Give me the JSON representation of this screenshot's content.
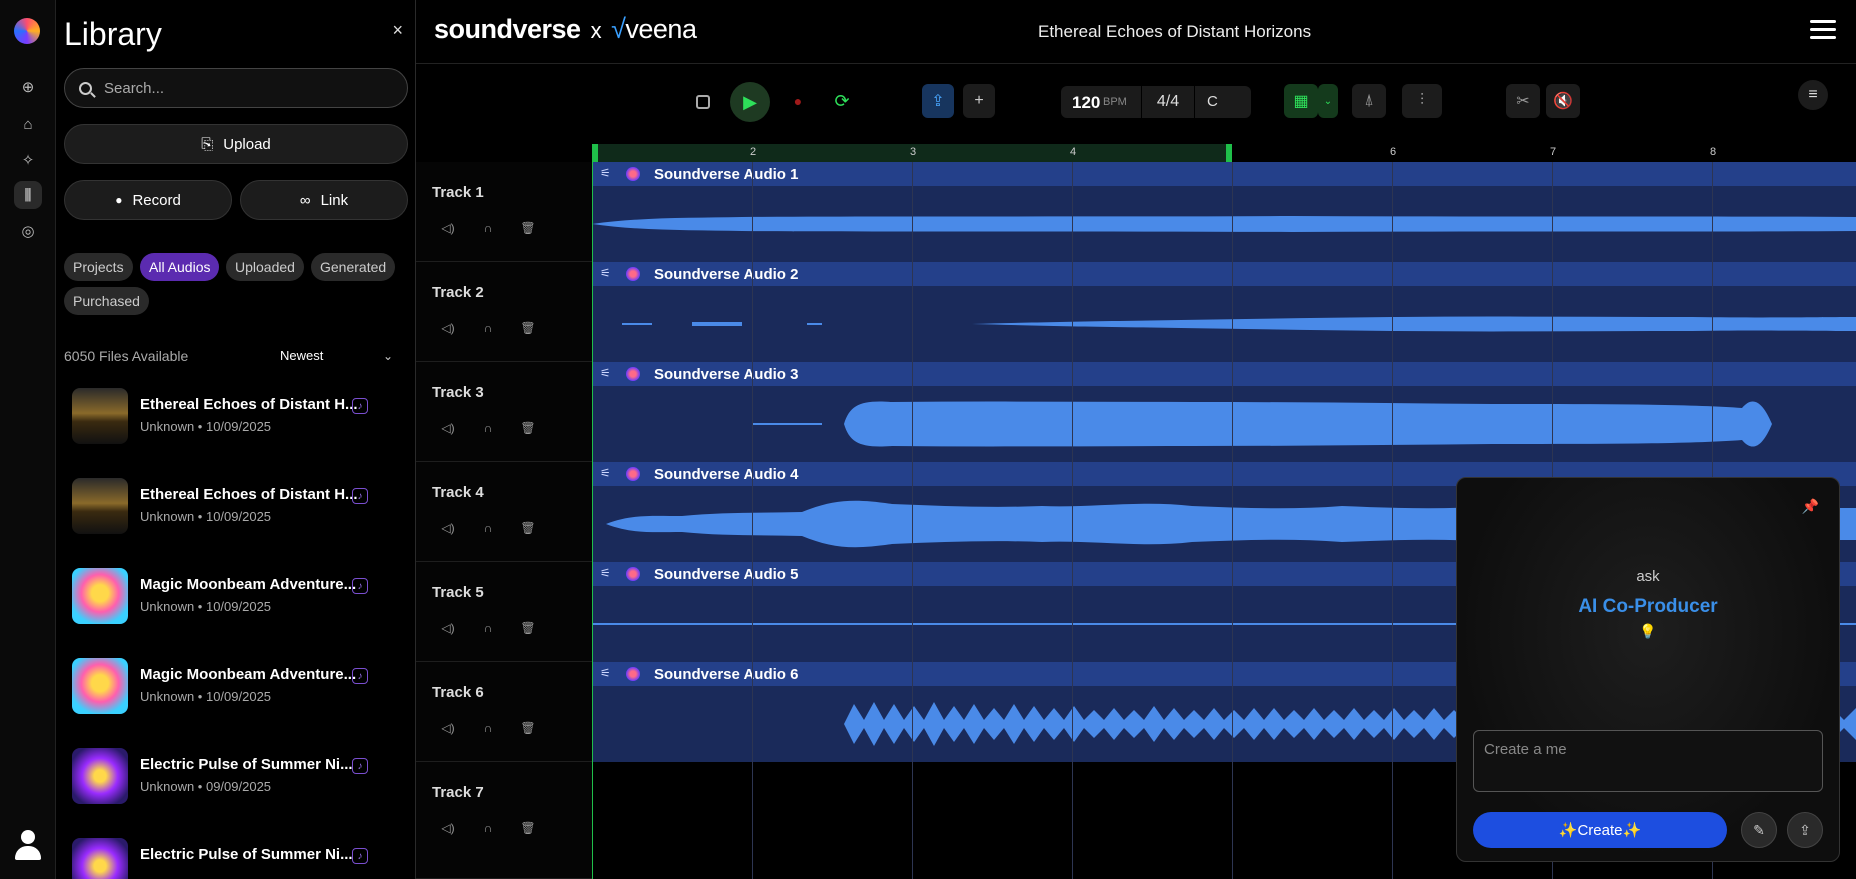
{
  "library": {
    "title": "Library",
    "close": "×",
    "search_placeholder": "Search...",
    "upload": "Upload",
    "record": "Record",
    "link": "Link",
    "filters": [
      "Projects",
      "All Audios",
      "Uploaded",
      "Generated",
      "Purchased"
    ],
    "active_filter": "All Audios",
    "files_count": "6050 Files Available",
    "sort": "Newest",
    "items": [
      {
        "title": "Ethereal Echoes of Distant H...",
        "sub": "Unknown • 10/09/2025"
      },
      {
        "title": "Ethereal Echoes of Distant H...",
        "sub": "Unknown • 10/09/2025"
      },
      {
        "title": "Magic Moonbeam Adventure...",
        "sub": "Unknown • 10/09/2025"
      },
      {
        "title": "Magic Moonbeam Adventure...",
        "sub": "Unknown • 10/09/2025"
      },
      {
        "title": "Electric Pulse of Summer Ni...",
        "sub": "Unknown • 09/09/2025"
      },
      {
        "title": "Electric Pulse of Summer Ni...",
        "sub": ""
      }
    ]
  },
  "header": {
    "brand_left": "soundverse",
    "brand_x": "x",
    "brand_right": "veena",
    "song_title": "Ethereal Echoes of Distant Horizons"
  },
  "transport": {
    "bpm": "120",
    "bpm_unit": "BPM",
    "time_signature": "4/4",
    "key": "C"
  },
  "ruler": [
    "2",
    "3",
    "4",
    "6",
    "7",
    "8"
  ],
  "tracks": [
    {
      "name": "Track 1",
      "clip": "Soundverse Audio 1"
    },
    {
      "name": "Track 2",
      "clip": "Soundverse Audio 2"
    },
    {
      "name": "Track 3",
      "clip": "Soundverse Audio 3"
    },
    {
      "name": "Track 4",
      "clip": "Soundverse Audio 4"
    },
    {
      "name": "Track 5",
      "clip": "Soundverse Audio 5"
    },
    {
      "name": "Track 6",
      "clip": "Soundverse Audio 6"
    },
    {
      "name": "Track 7",
      "clip": ""
    }
  ],
  "ai_panel": {
    "ask": "ask",
    "title": "AI Co-Producer",
    "bulb": "💡",
    "input_value": "Create a me",
    "create": "✨Create✨"
  },
  "colors": {
    "accent_purple": "#5b2bb0",
    "accent_blue": "#1d4ee0",
    "play_green": "#1fbf4a",
    "clip_bg": "#1a2a5a",
    "wave": "#4a8ae8"
  }
}
